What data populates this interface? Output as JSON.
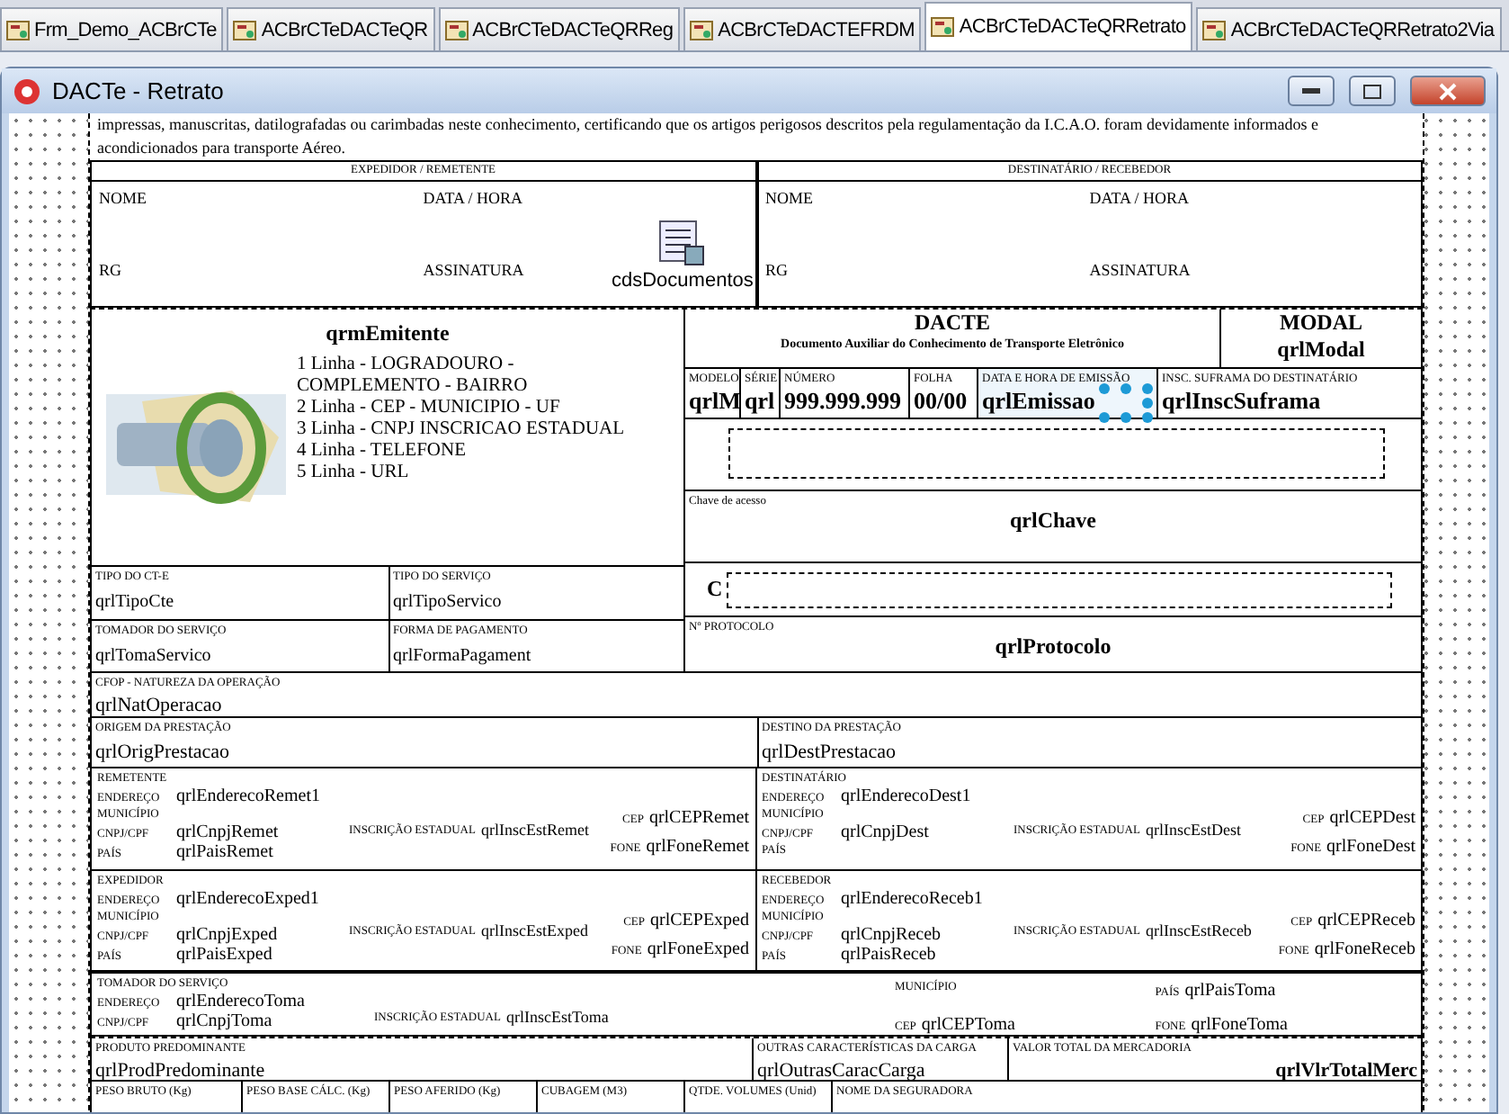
{
  "tabs": [
    {
      "label": "Frm_Demo_ACBrCTe",
      "selected": false
    },
    {
      "label": "ACBrCTeDACTeQR",
      "selected": false
    },
    {
      "label": "ACBrCTeDACTeQRReg",
      "selected": false
    },
    {
      "label": "ACBrCTeDACTEFRDM",
      "selected": false
    },
    {
      "label": "ACBrCTeDACTeQRRetrato",
      "selected": true
    },
    {
      "label": "ACBrCTeDACTeQRRetrato2Via",
      "selected": false
    }
  ],
  "window": {
    "title": "DACTe - Retrato"
  },
  "report": {
    "notice": "impressas, manuscritas, datilografadas ou carimbadas neste conhecimento, certificando que os artigos perigosos descritos pela regulamentação da I.C.A.O. foram devidamente informados e acondicionados para transporte Aéreo.",
    "receipt": [
      {
        "header": "EXPEDIDOR / REMETENTE",
        "fields": [
          "NOME",
          "DATA / HORA",
          "RG",
          "ASSINATURA"
        ]
      },
      {
        "header": "DESTINATÁRIO / RECEBEDOR",
        "fields": [
          "NOME",
          "DATA / HORA",
          "RG",
          "ASSINATURA"
        ]
      }
    ],
    "component": {
      "label": "cdsDocumentos"
    },
    "emitente": {
      "title": "qrmEmitente",
      "lines": [
        "1 Linha - LOGRADOURO - COMPLEMENTO - BAIRRO",
        "2 Linha - CEP - MUNICIPIO - UF",
        "3 Linha - CNPJ INSCRICAO ESTADUAL",
        "4 Linha - TELEFONE",
        "5 Linha - URL"
      ]
    },
    "dacte": {
      "title": "DACTE",
      "subtitle": "Documento Auxiliar do Conhecimento de Transporte Eletrônico"
    },
    "modal": {
      "label": "MODAL",
      "value": "qrlModal"
    },
    "doc_fields": [
      {
        "label": "MODELO",
        "value": "qrlM",
        "selected": false
      },
      {
        "label": "SÉRIE",
        "value": "qrl",
        "selected": false
      },
      {
        "label": "NÚMERO",
        "value": "999.999.999",
        "selected": false
      },
      {
        "label": "FOLHA",
        "value": "00/00",
        "selected": false
      },
      {
        "label": "DATA E HORA DE EMISSÃO",
        "value": "qrlEmissao",
        "selected": true
      },
      {
        "label": "INSC. SUFRAMA DO DESTINATÁRIO",
        "value": "qrlInscSuframa",
        "selected": false
      }
    ],
    "chave": {
      "label": "Chave de acesso",
      "value": "qrlChave"
    },
    "consulta": {
      "value": "C"
    },
    "protocolo": {
      "label": "Nº PROTOCOLO",
      "value": "qrlProtocolo"
    },
    "tipo_fields": [
      {
        "label": "TIPO DO CT-E",
        "value": "qrlTipoCte"
      },
      {
        "label": "TIPO DO SERVIÇO",
        "value": "qrlTipoServico"
      },
      {
        "label": "TOMADOR DO SERVIÇO",
        "value": "qrlTomaServico"
      },
      {
        "label": "FORMA DE PAGAMENTO",
        "value": "qrlFormaPagament"
      }
    ],
    "natureza": {
      "label": "CFOP - NATUREZA DA OPERAÇÃO",
      "value": "qrlNatOperacao"
    },
    "origem": {
      "label": "ORIGEM DA PRESTAÇÃO",
      "value": "qrlOrigPrestacao"
    },
    "destino": {
      "label": "DESTINO DA PRESTAÇÃO",
      "value": "qrlDestPrestacao"
    },
    "parties": [
      {
        "role": "REMETENTE",
        "left": [
          {
            "label": "ENDEREÇO",
            "value": "qrlEnderecoRemet1"
          },
          {
            "label": "MUNICÍPIO"
          },
          {
            "label": "CNPJ/CPF",
            "value": "qrlCnpjRemet"
          },
          {
            "label": "PAÍS",
            "value": "qrlPaisRemet"
          }
        ],
        "ie": {
          "label": "INSCRIÇÃO ESTADUAL",
          "value": "qrlInscEstRemet"
        },
        "cep": {
          "label": "CEP",
          "value": "qrlCEPRemet"
        },
        "fone": {
          "label": "FONE",
          "value": "qrlFoneRemet"
        }
      },
      {
        "role": "DESTINATÁRIO",
        "left": [
          {
            "label": "ENDEREÇO",
            "value": "qrlEnderecoDest1"
          },
          {
            "label": "MUNICÍPIO"
          },
          {
            "label": "CNPJ/CPF",
            "value": "qrlCnpjDest"
          },
          {
            "label": "PAÍS"
          }
        ],
        "ie": {
          "label": "INSCRIÇÃO ESTADUAL",
          "value": "qrlInscEstDest"
        },
        "cep": {
          "label": "CEP",
          "value": "qrlCEPDest"
        },
        "fone": {
          "label": "FONE",
          "value": "qrlFoneDest"
        }
      },
      {
        "role": "EXPEDIDOR",
        "left": [
          {
            "label": "ENDEREÇO",
            "value": "qrlEnderecoExped1"
          },
          {
            "label": "MUNICÍPIO"
          },
          {
            "label": "CNPJ/CPF",
            "value": "qrlCnpjExped"
          },
          {
            "label": "PAÍS",
            "value": "qrlPaisExped"
          }
        ],
        "ie": {
          "label": "INSCRIÇÃO ESTADUAL",
          "value": "qrlInscEstExped"
        },
        "cep": {
          "label": "CEP",
          "value": "qrlCEPExped"
        },
        "fone": {
          "label": "FONE",
          "value": "qrlFoneExped"
        }
      },
      {
        "role": "RECEBEDOR",
        "left": [
          {
            "label": "ENDEREÇO",
            "value": "qrlEnderecoReceb1"
          },
          {
            "label": "MUNICÍPIO"
          },
          {
            "label": "CNPJ/CPF",
            "value": "qrlCnpjReceb"
          },
          {
            "label": "PAÍS",
            "value": "qrlPaisReceb"
          }
        ],
        "ie": {
          "label": "INSCRIÇÃO ESTADUAL",
          "value": "qrlInscEstReceb"
        },
        "cep": {
          "label": "CEP",
          "value": "qrlCEPReceb"
        },
        "fone": {
          "label": "FONE",
          "value": "qrlFoneReceb"
        }
      }
    ],
    "tomador": {
      "role": "TOMADOR DO SERVIÇO",
      "left": [
        {
          "label": "ENDEREÇO",
          "value": "qrlEnderecoToma"
        },
        {
          "label": "CNPJ/CPF",
          "value": "qrlCnpjToma"
        }
      ],
      "ie": {
        "label": "INSCRIÇÃO ESTADUAL",
        "value": "qrlInscEstToma"
      },
      "right": [
        {
          "label": "MUNICÍPIO"
        },
        {
          "label": "PAÍS",
          "value": "qrlPaisToma"
        },
        {
          "label": "CEP",
          "value": "qrlCEPToma"
        },
        {
          "label": "FONE",
          "value": "qrlFoneToma"
        }
      ]
    },
    "carga": [
      {
        "label": "PRODUTO PREDOMINANTE",
        "value": "qrlProdPredominante"
      },
      {
        "label": "OUTRAS CARACTERÍSTICAS DA CARGA",
        "value": "qrlOutrasCaracCarga"
      },
      {
        "label": "VALOR TOTAL DA MERCADORIA",
        "value": "qrlVlrTotalMerc"
      }
    ],
    "pesos": [
      "PESO BRUTO (Kg)",
      "PESO BASE CÁLC. (Kg)",
      "PESO AFERIDO (Kg)",
      "CUBAGEM (M3)",
      "QTDE. VOLUMES (Unid)",
      "NOME DA SEGURADORA"
    ]
  }
}
